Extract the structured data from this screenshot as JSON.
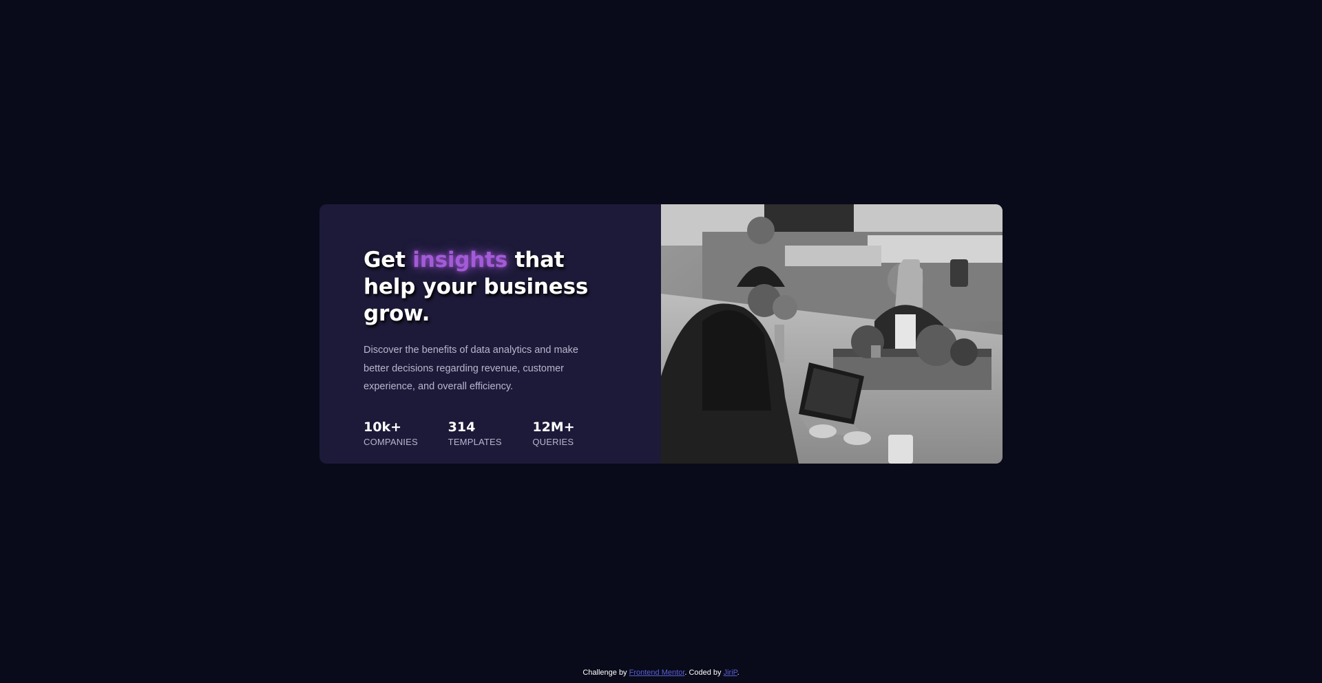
{
  "card": {
    "headline": {
      "before": "Get ",
      "accent": "insights",
      "after": " that help your business grow."
    },
    "description": "Discover the benefits of data analytics and make better decisions regarding revenue, customer experience, and overall efficiency.",
    "stats": [
      {
        "value": "10k+",
        "label": "COMPANIES"
      },
      {
        "value": "314",
        "label": "TEMPLATES"
      },
      {
        "value": "12M+",
        "label": "QUERIES"
      }
    ]
  },
  "footer": {
    "prefix": "Challenge by ",
    "mentor_link": "Frontend Mentor",
    "middle": ". Coded by ",
    "author_link": "JiriP",
    "suffix": "."
  },
  "colors": {
    "background": "#090b1a",
    "card": "#1c1a38",
    "accent": "#a35bd8",
    "link": "#5a5fd6"
  }
}
